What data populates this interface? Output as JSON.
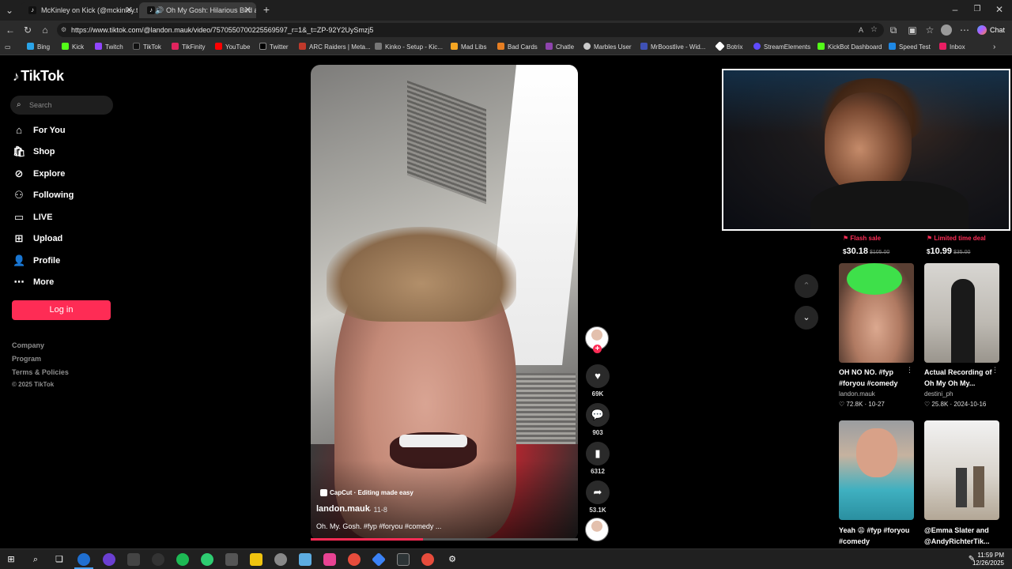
{
  "browser": {
    "tabs": [
      {
        "title": "McKinley on Kick (@mckinley.tv) |",
        "icon": "tiktok-icon"
      },
      {
        "title": "Oh My Gosh: Hilarious Bird an",
        "icon": "tiktok-icon",
        "active": true
      }
    ],
    "new_tab": "+",
    "url": "https://www.tiktok.com/@landon.mauk/video/7570550700225569597_r=1&_t=ZP-92Y2UySmzj5",
    "chat_label": "Chat",
    "bookmarks": [
      "Bing",
      "Kick",
      "Twitch",
      "TikTok",
      "TikFinity",
      "YouTube",
      "Twitter",
      "ARC Raiders | Meta...",
      "Kinko - Setup - Kic...",
      "Mad Libs",
      "Bad Cards",
      "Chatle",
      "Marbles User",
      "MrBoostlive - Wid...",
      "Botrix",
      "StreamElements",
      "KickBot Dashboard",
      "Speed Test",
      "Inbox"
    ]
  },
  "sidebar": {
    "logo": "TikTok",
    "search_placeholder": "Search",
    "nav": [
      {
        "label": "For You",
        "icon": "home-icon"
      },
      {
        "label": "Shop",
        "icon": "shopping-bag-icon"
      },
      {
        "label": "Explore",
        "icon": "compass-icon"
      },
      {
        "label": "Following",
        "icon": "following-icon"
      },
      {
        "label": "LIVE",
        "icon": "live-icon"
      },
      {
        "label": "Upload",
        "icon": "upload-icon"
      },
      {
        "label": "Profile",
        "icon": "profile-icon"
      },
      {
        "label": "More",
        "icon": "more-icon"
      }
    ],
    "login": "Log in",
    "footer": [
      "Company",
      "Program",
      "Terms & Policies",
      "© 2025 TikTok"
    ]
  },
  "video": {
    "capcut": "CapCut · Editing made easy",
    "author": "landon.mauk",
    "date": "· 11-8",
    "caption": "Oh. My. Gosh. #fyp #foryou #comedy ...",
    "progress": 0.42,
    "likes": "69K",
    "comments": "903",
    "saves": "6312",
    "shares": "53.1K"
  },
  "deals": [
    {
      "tag": "Flash sale",
      "currency": "$",
      "price": "30.18",
      "orig": "$105.00"
    },
    {
      "tag": "Limited time deal",
      "currency": "$",
      "price": "10.99",
      "orig": "$35.00"
    }
  ],
  "grid": [
    {
      "title": "OH NO NO. #fyp #foryou #comedy",
      "author": "landon.mauk",
      "likes": "72.8K",
      "date": "10-27"
    },
    {
      "title": "Actual Recording of Oh My Oh My...",
      "author": "destini_ph",
      "likes": "25.8K",
      "date": "2024-10-16"
    },
    {
      "title": "Yeah 😩 #fyp #foryou #comedy",
      "author": "",
      "likes": "",
      "date": ""
    },
    {
      "title": "@Emma Slater and @AndyRichterTik...",
      "author": "",
      "likes": "",
      "date": ""
    }
  ],
  "taskbar": {
    "time": "11:59 PM",
    "date": "12/26/2025"
  },
  "colors": {
    "accent": "#fe2c55",
    "bg": "#000000"
  }
}
